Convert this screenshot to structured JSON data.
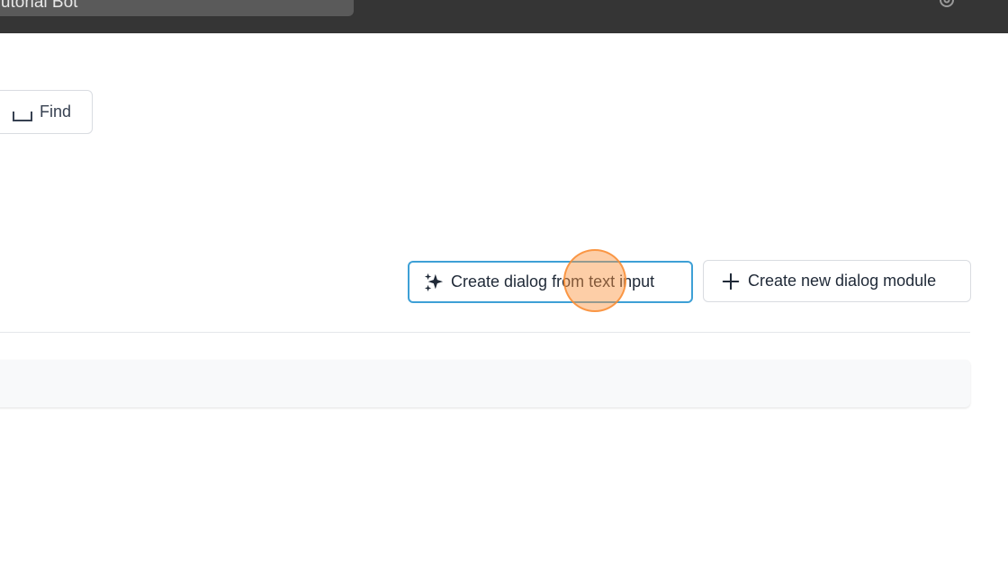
{
  "topbar": {
    "bot_name": "Tutorial Bot",
    "settings_icon": "gear-icon"
  },
  "toolbar": {
    "find_label": "Find",
    "find_icon": "space-key-icon"
  },
  "actions": {
    "create_from_text_label": "Create dialog from text input",
    "create_from_text_icon": "sparkles-icon",
    "create_new_module_label": "Create new dialog module",
    "create_new_module_icon": "plus-icon"
  },
  "colors": {
    "topbar_bg": "#353535",
    "accent_focus": "#3ea0d6",
    "click_indicator": "#fb923c"
  }
}
